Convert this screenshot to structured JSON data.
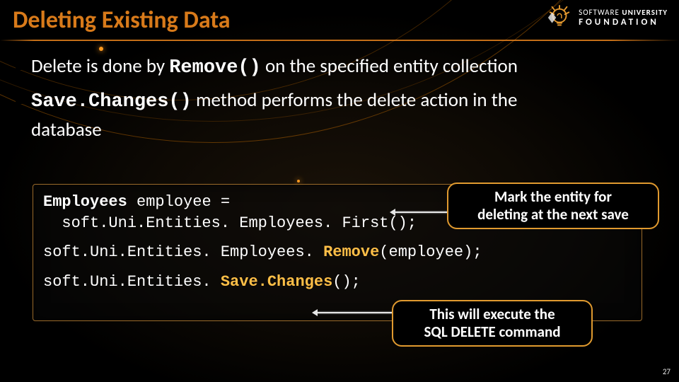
{
  "title": "Deleting Existing Data",
  "logo": {
    "line1_light": "SOFTWARE",
    "line1_bold": "UNIVERSITY",
    "line2": "FOUNDATION"
  },
  "bullets": {
    "b1_pre": "Delete is done by ",
    "b1_code": "Remove()",
    "b1_post": " on the specified entity collection",
    "b2_code": "Save.Changes()",
    "b2_mid": " method performs the delete action in the",
    "b2_cont": "database"
  },
  "code": {
    "l1a": "Employees",
    "l1b": " employee =",
    "l2": "  soft.Uni.Entities. Employees. First();",
    "l3a": "soft.Uni.Entities. Employees. ",
    "l3b": "Remove",
    "l3c": "(employee);",
    "l4a": "soft.Uni.Entities. ",
    "l4b": "Save.Changes",
    "l4c": "();"
  },
  "callouts": {
    "c1_l1": "Mark the entity for",
    "c1_l2": "deleting at the next save",
    "c2_l1": "This will execute the",
    "c2_l2": "SQL DELETE command"
  },
  "page_number": "27"
}
